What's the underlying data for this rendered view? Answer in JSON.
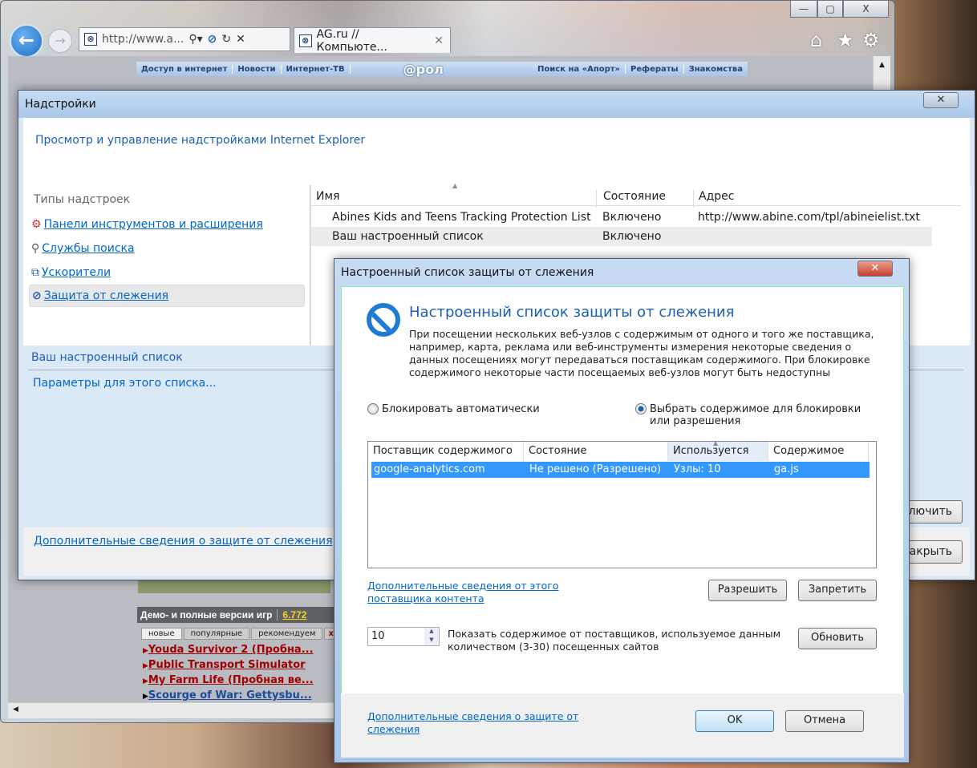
{
  "browser": {
    "address": "http://www.a...",
    "tab_title": "AG.ru // Компьюте...",
    "controls": [
      "minimize",
      "maximize",
      "close"
    ]
  },
  "webpage": {
    "nav_left": [
      "Доступ в интернет",
      "Новости",
      "Интернет-ТВ"
    ],
    "logo": "@рол",
    "nav_right": [
      "Поиск на «Апорт»",
      "Рефераты",
      "Знакомства"
    ],
    "section_title": "Демо- и полные версии игр",
    "count": "6.772",
    "tabs": [
      "новые",
      "популярные",
      "рекомендуем",
      "xtre"
    ],
    "games": [
      {
        "title": "Youda Survivor 2 (Пробна...",
        "color": "#a00000"
      },
      {
        "title": "Public Transport Simulator",
        "color": "#a00000"
      },
      {
        "title": "My Farm Life (Пробная ве...",
        "color": "#a00000"
      },
      {
        "title": "Scourge of War: Gettysbu...",
        "color": "#1a4a9a"
      }
    ]
  },
  "addons": {
    "title": "Надстройки",
    "header": "Просмотр и управление надстройками Internet Explorer",
    "types_label": "Типы надстроек",
    "types": [
      "Панели инструментов и расширения",
      "Службы поиска",
      "Ускорители",
      "Защита от слежения"
    ],
    "columns": [
      "Имя",
      "Состояние",
      "Адрес"
    ],
    "rows": [
      {
        "name": "Abines Kids and Teens Tracking Protection List",
        "state": "Включено",
        "address": "http://www.abine.com/tpl/abineielist.txt"
      },
      {
        "name": "Ваш настроенный список",
        "state": "Включено",
        "address": ""
      }
    ],
    "detail_title": "Ваш настроенный список",
    "detail_link": "Параметры для этого списка...",
    "disable_btn": "лючить",
    "close_btn": "акрыть",
    "footer_link": "Дополнительные сведения о защите от слежения"
  },
  "tracking": {
    "title": "Настроенный список защиты от слежения",
    "heading": "Настроенный список защиты от слежения",
    "description": "При посещении нескольких веб-узлов с содержимым от одного и того же поставщика, например, карта, реклама или веб-инструменты измерения некоторые сведения о данных посещениях могут передаваться поставщикам содержимого. При блокировке содержимого некоторые части посещаемых веб-узлов могут быть недоступны",
    "radio_auto": "Блокировать автоматически",
    "radio_manual": "Выбрать содержимое для блокировки или разрешения",
    "selected_radio": "manual",
    "columns": [
      "Поставщик содержимого",
      "Состояние",
      "Используется",
      "Содержимое"
    ],
    "rows": [
      {
        "provider": "google-analytics.com",
        "state": "Не решено (Разрешено)",
        "used": "Узлы: 10",
        "content": "ga.js"
      }
    ],
    "provider_link": "Дополнительные сведения от этого поставщика контента",
    "allow": "Разрешить",
    "block": "Запретить",
    "spinner_value": "10",
    "spinner_label": "Показать содержимое от поставщиков, используемое данным количеством (3-30) посещенных сайтов",
    "refresh": "Обновить",
    "footer_link": "Дополнительные сведения о защите от слежения",
    "ok": "OK",
    "cancel": "Отмена",
    "selection_color": "#3399ff"
  }
}
